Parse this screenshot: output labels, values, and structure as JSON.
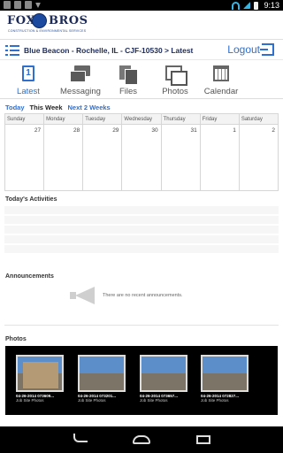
{
  "status_bar": {
    "time": "9:13",
    "icons": [
      "notification-icon",
      "warning-icon",
      "image-icon",
      "download-icon",
      "wifi-icon",
      "signal-icon",
      "battery-icon"
    ]
  },
  "brand": {
    "left_word": "FOX",
    "right_word": "BROS",
    "tagline": "CONSTRUCTION & ENVIRONMENTAL SERVICES",
    "primary_color": "#1c2a55",
    "accent_color": "#2e6fd0"
  },
  "breadcrumb": {
    "text": "Blue Beacon - Rochelle, IL - CJF-10530 > Latest",
    "logout_label": "Logout"
  },
  "tabs": [
    {
      "label": "Latest",
      "icon": "calendar-day-icon",
      "badge": "1",
      "active": true
    },
    {
      "label": "Messaging",
      "icon": "chat-bubbles-icon",
      "active": false
    },
    {
      "label": "Files",
      "icon": "documents-icon",
      "active": false
    },
    {
      "label": "Photos",
      "icon": "photos-icon",
      "active": false
    },
    {
      "label": "Calendar",
      "icon": "calendar-icon",
      "active": false
    }
  ],
  "week_nav": {
    "today": "Today",
    "this_week": "This Week",
    "next_two_weeks": "Next 2 Weeks"
  },
  "calendar": {
    "days": [
      "Sunday",
      "Monday",
      "Tuesday",
      "Wednesday",
      "Thursday",
      "Friday",
      "Saturday"
    ],
    "dates": [
      "27",
      "28",
      "29",
      "30",
      "31",
      "1",
      "2"
    ]
  },
  "activities": {
    "title": "Today's Activities",
    "rows": 5
  },
  "announcements": {
    "title": "Announcements",
    "empty_text": "There are no recent announcements."
  },
  "photos": {
    "title": "Photos",
    "items": [
      {
        "caption": "04-26-2014 073609...",
        "album": "Job Site Photos"
      },
      {
        "caption": "04-26-2014 073201...",
        "album": "Job Site Photos"
      },
      {
        "caption": "04-26-2014 073657...",
        "album": "Job Site Photos"
      },
      {
        "caption": "04-26-2014 072827...",
        "album": "Job Site Photos"
      }
    ]
  }
}
